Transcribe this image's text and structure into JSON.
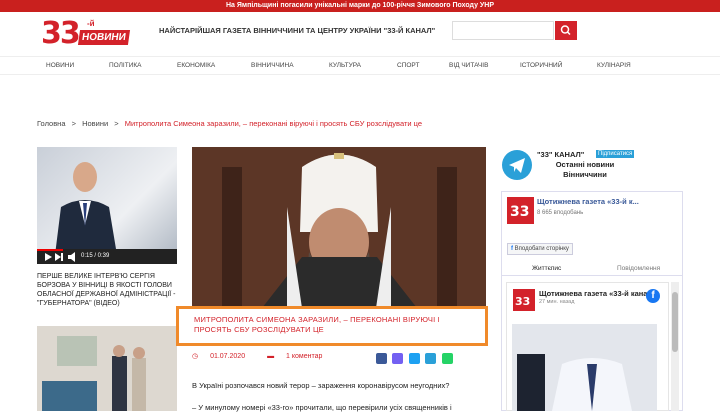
{
  "topbar": {
    "text": "На Ямпільщині погасили унікальні марки до 100-річчя Зимового Походу УНР"
  },
  "header": {
    "logo_number": "33",
    "logo_sup": "-й",
    "logo_word": "НОВИНИ",
    "tagline": "НАЙСТАРІЙШАЯ ГАЗЕТА ВІННИЧЧИНИ ТА ЦЕНТРУ УКРАЇНИ \"33-Й КАНАЛ\"",
    "search_placeholder": ""
  },
  "nav": [
    "НОВИНИ",
    "ПОЛІТИКА",
    "ЕКОНОМІКА",
    "ВІННИЧЧИНА",
    "КУЛЬТУРА",
    "СПОРТ",
    "ВІД ЧИТАЧІВ",
    "ІСТОРИЧНИЙ",
    "КУЛІНАРІЯ"
  ],
  "breadcrumb": {
    "home": "Головна",
    "sep": ">",
    "section": "Новини",
    "current": "Митрополита Симеона заразили, – переконані віруючі і просять СБУ розслідувати це"
  },
  "left": {
    "video_time": "0:15 / 0:39",
    "title": "ПЕРШЕ ВЕЛИКЕ ІНТЕРВ'Ю СЕРГІЯ БОРЗОВА У ВІННИЦІ В ЯКОСТІ ГОЛОВИ ОБЛАСНОЇ ДЕРЖАВНОЇ АДМІНІСТРАЦІЇ - \"ГУБЕРНАТОРА\" (ВІДЕО)"
  },
  "article": {
    "headline_line1": "МИТРОПОЛИТА СИМЕОНА ЗАРАЗИЛИ, – ПЕРЕКОНАНІ ВІРУЮЧІ І",
    "headline_line2": "ПРОСЯТЬ СБУ РОЗСЛІДУВАТИ ЦЕ",
    "date": "01.07.2020",
    "comments": "1 коментар",
    "para1": "В Україні розпочався новий терор – зараження коронавірусом неугодних?",
    "para2": "– У минулому номері «33-го» прочитали, що перевірили усіх священників і"
  },
  "telegram": {
    "title": "\"33\" КАНАЛ\"",
    "subscribe": "Підписатися",
    "text_line1": "Останні новини",
    "text_line2": "Вінниччини"
  },
  "facebook": {
    "page_name": "Щотижнева газета «33-й к...",
    "followers": "8 665 вподобань",
    "like_label": "Вподобати сторінку",
    "tab_timeline": "Життєпис",
    "tab_events": "Повідомлення",
    "post_name": "Щотижнева газета «33-й канал»",
    "post_time": "27 мин. назад"
  },
  "colors": {
    "brand_red": "#d3222a",
    "highlight_orange": "#f08a2a",
    "telegram_blue": "#2aa0d8",
    "fb_blue": "#1877f2"
  }
}
